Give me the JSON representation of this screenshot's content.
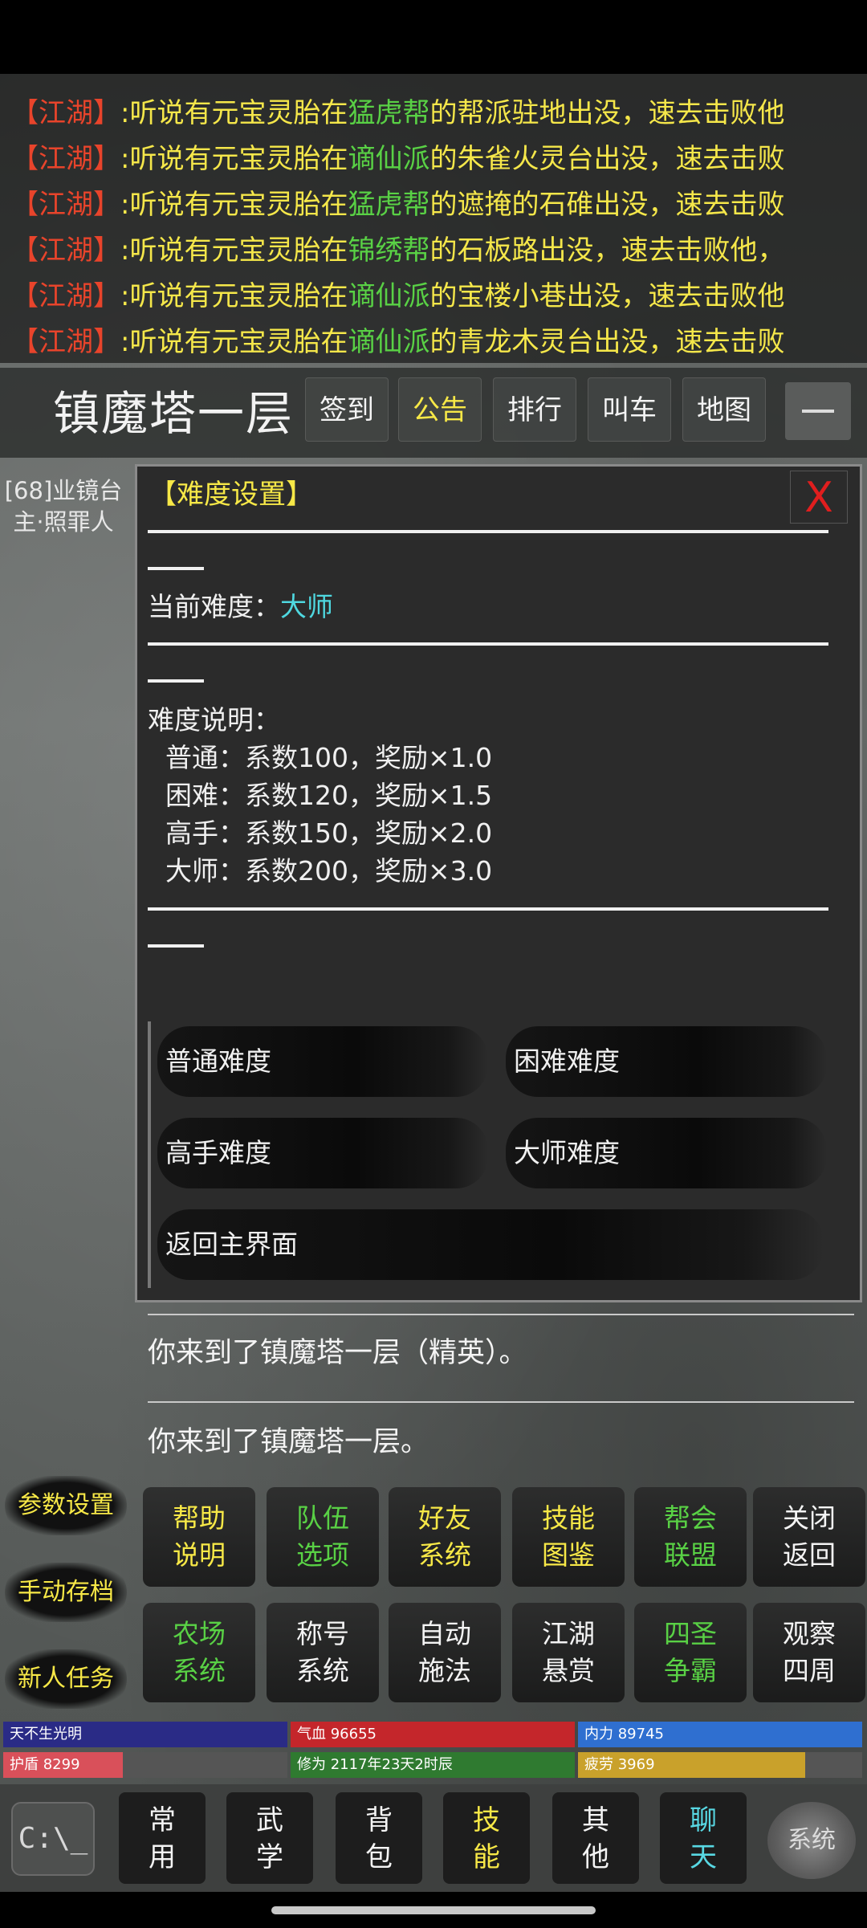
{
  "news": [
    {
      "tag": "【江湖】",
      "pre": ":听说有元宝灵胎在",
      "sect": "猛虎帮",
      "post": "的帮派驻地出没，速去击败他"
    },
    {
      "tag": "【江湖】",
      "pre": ":听说有元宝灵胎在",
      "sect": "谪仙派",
      "post": "的朱雀火灵台出没，速去击败"
    },
    {
      "tag": "【江湖】",
      "pre": ":听说有元宝灵胎在",
      "sect": "猛虎帮",
      "post": "的遮掩的石碓出没，速去击败"
    },
    {
      "tag": "【江湖】",
      "pre": ":听说有元宝灵胎在",
      "sect": "锦绣帮",
      "post": "的石板路出没，速去击败他，"
    },
    {
      "tag": "【江湖】",
      "pre": ":听说有元宝灵胎在",
      "sect": "谪仙派",
      "post": "的宝楼小巷出没，速去击败他"
    },
    {
      "tag": "【江湖】",
      "pre": ":听说有元宝灵胎在",
      "sect": "谪仙派",
      "post": "的青龙木灵台出没，速去击败"
    }
  ],
  "header": {
    "location": "镇魔塔一层",
    "buttons": [
      "签到",
      "公告",
      "排行",
      "叫车",
      "地图"
    ]
  },
  "npc": "[68]业镜台主·照罪人",
  "dialog": {
    "title": "【难度设置】",
    "close": "X",
    "current_label": "当前难度：",
    "current_value": "大师",
    "desc_label": "难度说明：",
    "desc_lines": [
      "普通：系数100，奖励×1.0",
      "困难：系数120，奖励×1.5",
      "高手：系数150，奖励×2.0",
      "大师：系数200，奖励×3.0"
    ],
    "options": [
      "普通难度",
      "困难难度",
      "高手难度",
      "大师难度",
      "返回主界面"
    ]
  },
  "log": [
    "你来到了镇魔塔一层（精英）。",
    "你来到了镇魔塔一层。"
  ],
  "side_buttons": [
    "参数设置",
    "手动存档",
    "新人任务"
  ],
  "grid_buttons": [
    {
      "l1": "帮助",
      "l2": "说明",
      "color": "yellow"
    },
    {
      "l1": "队伍",
      "l2": "选项",
      "color": "green"
    },
    {
      "l1": "好友",
      "l2": "系统",
      "color": "yellow"
    },
    {
      "l1": "技能",
      "l2": "图鉴",
      "color": "yellow"
    },
    {
      "l1": "帮会",
      "l2": "联盟",
      "color": "green"
    },
    {
      "l1": "关闭",
      "l2": "返回",
      "color": "white"
    },
    {
      "l1": "农场",
      "l2": "系统",
      "color": "green"
    },
    {
      "l1": "称号",
      "l2": "系统",
      "color": "white"
    },
    {
      "l1": "自动",
      "l2": "施法",
      "color": "white"
    },
    {
      "l1": "江湖",
      "l2": "悬赏",
      "color": "white"
    },
    {
      "l1": "四圣",
      "l2": "争霸",
      "color": "green"
    },
    {
      "l1": "观察",
      "l2": "四周",
      "color": "white"
    }
  ],
  "stats": {
    "row1": [
      {
        "label": "天不生光明",
        "fill": 1.0,
        "color": "#2a2b86"
      },
      {
        "label": "气血 96655",
        "fill": 1.0,
        "color": "#c4262b"
      },
      {
        "label": "内力 89745",
        "fill": 1.0,
        "color": "#2f6fd0"
      }
    ],
    "row2": [
      {
        "label": "护盾 8299",
        "fill": 0.42,
        "color": "#d9505a"
      },
      {
        "label": "修为 2117年23天2时辰",
        "fill": 1.0,
        "color": "#2f7a30"
      },
      {
        "label": "疲劳 3969",
        "fill": 0.8,
        "color": "#c9a12b"
      }
    ]
  },
  "bottom_nav": [
    {
      "l1": "常",
      "l2": "用",
      "color": "white"
    },
    {
      "l1": "武",
      "l2": "学",
      "color": "white"
    },
    {
      "l1": "背",
      "l2": "包",
      "color": "white"
    },
    {
      "l1": "技",
      "l2": "能",
      "color": "yellow"
    },
    {
      "l1": "其",
      "l2": "他",
      "color": "white"
    },
    {
      "l1": "聊",
      "l2": "天",
      "color": "cyan"
    }
  ],
  "console_icon_text": "C:\\_",
  "system_icon_text": "系统"
}
